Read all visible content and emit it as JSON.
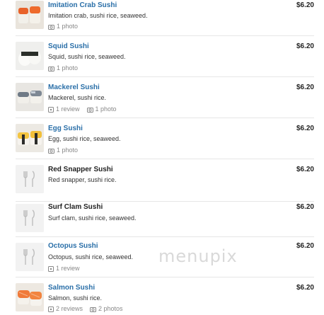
{
  "items": [
    {
      "name": "Imitation Crab Sushi",
      "desc": "Imitation crab, sushi rice, seaweed.",
      "price": "$6.20",
      "reviews": "",
      "photos": "1 photo",
      "linked": true,
      "thumb": "crab-sushi-photo"
    },
    {
      "name": "Squid Sushi",
      "desc": "Squid, sushi rice, seaweed.",
      "price": "$6.20",
      "reviews": "",
      "photos": "1 photo",
      "linked": true,
      "thumb": "squid-sushi-photo"
    },
    {
      "name": "Mackerel Sushi",
      "desc": "Mackerel, sushi rice.",
      "price": "$6.20",
      "reviews": "1 review",
      "photos": "1 photo",
      "linked": true,
      "thumb": "mackerel-sushi-photo"
    },
    {
      "name": "Egg Sushi",
      "desc": "Egg, sushi rice, seaweed.",
      "price": "$6.20",
      "reviews": "",
      "photos": "1 photo",
      "linked": true,
      "thumb": "egg-sushi-photo"
    },
    {
      "name": "Red Snapper Sushi",
      "desc": "Red snapper, sushi rice.",
      "price": "$6.20",
      "reviews": "",
      "photos": "",
      "linked": false,
      "thumb": "utensils-icon"
    },
    {
      "name": "Surf Clam Sushi",
      "desc": "Surf clam, sushi rice, seaweed.",
      "price": "$6.20",
      "reviews": "",
      "photos": "",
      "linked": false,
      "thumb": "utensils-icon"
    },
    {
      "name": "Octopus Sushi",
      "desc": "Octopus, sushi rice, seaweed.",
      "price": "$6.20",
      "reviews": "1 review",
      "photos": "",
      "linked": true,
      "thumb": "utensils-icon"
    },
    {
      "name": "Salmon Sushi",
      "desc": "Salmon, sushi rice.",
      "price": "$6.20",
      "reviews": "2 reviews",
      "photos": "2 photos",
      "linked": true,
      "thumb": "salmon-sushi-photo"
    }
  ],
  "watermark": "menupix",
  "colors": {
    "link": "#2a6fa8",
    "text": "#222222",
    "muted": "#888888",
    "divider": "#e6e6e6"
  }
}
